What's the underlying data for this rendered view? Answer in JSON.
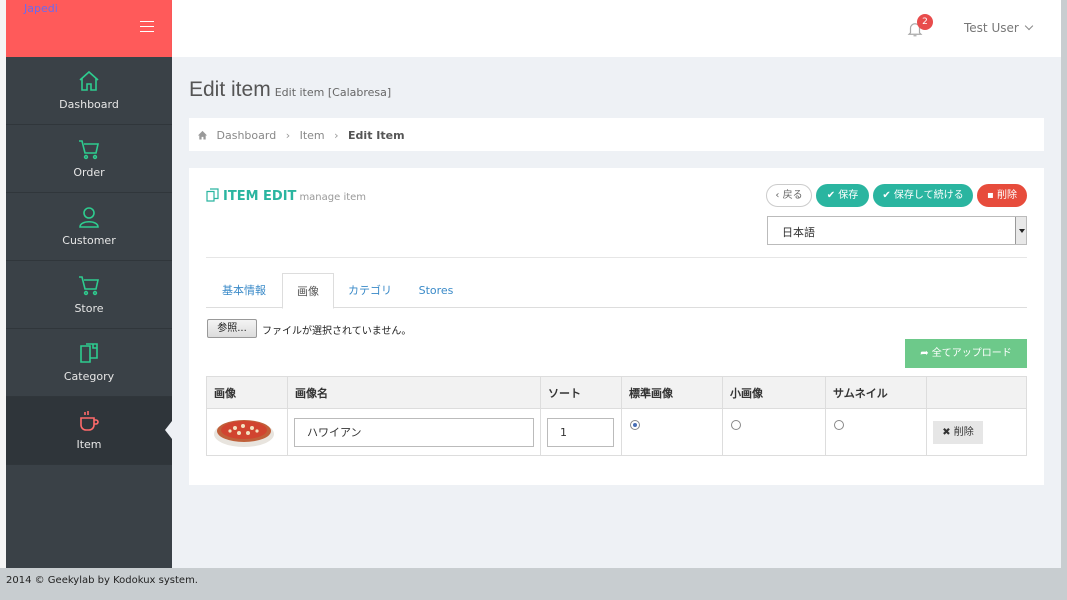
{
  "brand": {
    "name": "Japedi"
  },
  "sidebar": {
    "items": [
      {
        "label": "Dashboard",
        "icon": "home-icon"
      },
      {
        "label": "Order",
        "icon": "cart-icon"
      },
      {
        "label": "Customer",
        "icon": "user-icon"
      },
      {
        "label": "Store",
        "icon": "cart-icon"
      },
      {
        "label": "Category",
        "icon": "copy-icon"
      },
      {
        "label": "Item",
        "icon": "coffee-icon",
        "active": true
      }
    ]
  },
  "topbar": {
    "notification_count": "2",
    "user_name": "Test User"
  },
  "page": {
    "title": "Edit item",
    "subtitle": "Edit item [Calabresa]"
  },
  "breadcrumb": {
    "home": "Dashboard",
    "level1": "Item",
    "current": "Edit Item"
  },
  "panel": {
    "title": "ITEM EDIT",
    "subtitle": "manage item",
    "buttons": {
      "back": "戻る",
      "save": "保存",
      "save_continue": "保存して続ける",
      "delete": "削除"
    },
    "language": {
      "selected": "日本語"
    },
    "tabs": [
      "基本情報",
      "画像",
      "カテゴリ",
      "Stores"
    ],
    "active_tab": "画像",
    "file": {
      "button": "参照...",
      "status": "ファイルが選択されていません。"
    },
    "upload_all": "全てアップロード"
  },
  "image_table": {
    "headers": [
      "画像",
      "画像名",
      "ソート",
      "標準画像",
      "小画像",
      "サムネイル",
      ""
    ],
    "rows": [
      {
        "image_name": "ハワイアン",
        "sort": "1",
        "standard": true,
        "small": false,
        "thumbnail": false,
        "delete_label": "削除"
      }
    ]
  },
  "footer": {
    "text": "2014 © Geekylab by Kodokux system."
  },
  "colors": {
    "brand": "#ff5a5a",
    "accent": "#2ab5a0",
    "danger": "#e74c3c",
    "success": "#6dc98a",
    "sidebar": "#3a4147",
    "sidebar_icon": "#2ecc8f",
    "active_icon": "#ff6a6a"
  }
}
